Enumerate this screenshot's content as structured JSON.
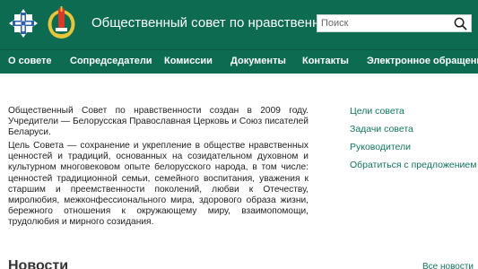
{
  "header": {
    "title": "Общественный совет по нравственности",
    "search_placeholder": "Поиск",
    "colors": {
      "primary": "#0d6b52",
      "link": "#12755c"
    }
  },
  "nav": {
    "items": [
      {
        "label": "О совете"
      },
      {
        "label": "Сопредседатели"
      },
      {
        "label": "Комиссии"
      },
      {
        "label": "Документы"
      },
      {
        "label": "Контакты"
      },
      {
        "label": "Электронное обращение"
      }
    ]
  },
  "main": {
    "intro": "Общественный Совет по нравственности создан в 2009 году. Учредители — Белорусская Православная Церковь и Союз писателей Беларуси.",
    "goal": "Цель Совета — сохранение и укрепление в обществе нравственных ценностей и традиций, основанных на созидательном духовном и культурном многовековом опыте белорусского народа, в том числе: ценностей традиционной семьи, семейного воспитания, уважения к старшим и преемственности поколений, любви к Отечеству, миролюбия, межконфессионального мира, здорового образа жизни, бережного отношения к окружающему миру, взаимопомощи, трудолюбия и мирного созидания."
  },
  "sidebar": {
    "links": [
      {
        "label": "Цели совета"
      },
      {
        "label": "Задачи совета"
      },
      {
        "label": "Руководители"
      },
      {
        "label": "Обратиться с предложением"
      }
    ]
  },
  "news": {
    "title": "Новости",
    "all_link": "Все новости"
  },
  "icons": [
    "logo-cross-emblem-icon",
    "logo-wheat-emblem-icon",
    "search-icon"
  ]
}
